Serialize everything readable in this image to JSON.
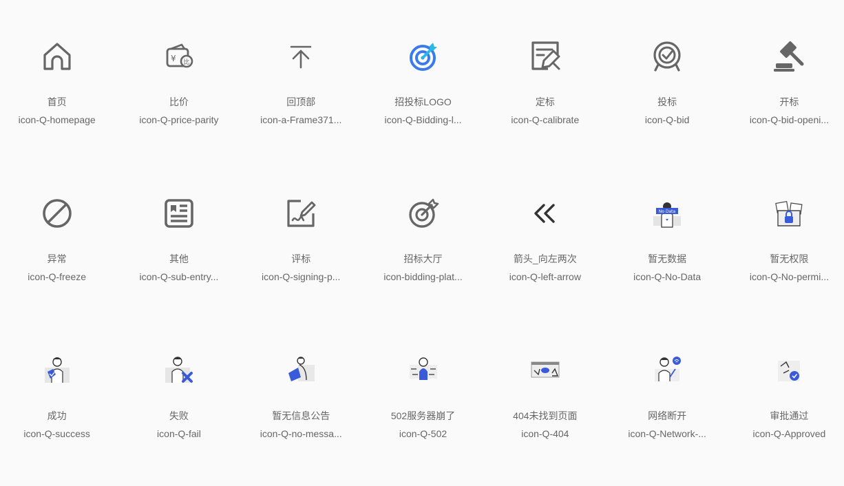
{
  "icons": [
    {
      "name": "首页",
      "code": "icon-Q-homepage",
      "glyph": "home-icon"
    },
    {
      "name": "比价",
      "code": "icon-Q-price-parity",
      "glyph": "price-parity-icon"
    },
    {
      "name": "回顶部",
      "code": "icon-a-Frame371...",
      "glyph": "back-to-top-icon"
    },
    {
      "name": "招投标LOGO",
      "code": "icon-Q-Bidding-l...",
      "glyph": "bidding-logo-icon"
    },
    {
      "name": "定标",
      "code": "icon-Q-calibrate",
      "glyph": "calibrate-icon"
    },
    {
      "name": "投标",
      "code": "icon-Q-bid",
      "glyph": "bid-icon"
    },
    {
      "name": "开标",
      "code": "icon-Q-bid-openi...",
      "glyph": "gavel-icon"
    },
    {
      "name": "异常",
      "code": "icon-Q-freeze",
      "glyph": "freeze-icon"
    },
    {
      "name": "其他",
      "code": "icon-Q-sub-entry...",
      "glyph": "sub-entry-icon"
    },
    {
      "name": "评标",
      "code": "icon-Q-signing-p...",
      "glyph": "signing-icon"
    },
    {
      "name": "招标大厅",
      "code": "icon-bidding-plat...",
      "glyph": "bidding-platform-icon"
    },
    {
      "name": "箭头_向左两次",
      "code": "icon-Q-left-arrow",
      "glyph": "double-left-arrow-icon"
    },
    {
      "name": "暂无数据",
      "code": "icon-Q-No-Data",
      "glyph": "no-data-illustration-icon",
      "badge": "No Data"
    },
    {
      "name": "暂无权限",
      "code": "icon-Q-No-permi...",
      "glyph": "no-permission-illustration-icon"
    },
    {
      "name": "成功",
      "code": "icon-Q-success",
      "glyph": "success-illustration-icon"
    },
    {
      "name": "失败",
      "code": "icon-Q-fail",
      "glyph": "fail-illustration-icon"
    },
    {
      "name": "暂无信息公告",
      "code": "icon-Q-no-messa...",
      "glyph": "no-message-illustration-icon"
    },
    {
      "name": "502服务器崩了",
      "code": "icon-Q-502",
      "glyph": "server-502-illustration-icon"
    },
    {
      "name": "404未找到页面",
      "code": "icon-Q-404",
      "glyph": "page-404-illustration-icon"
    },
    {
      "name": "网络断开",
      "code": "icon-Q-Network-...",
      "glyph": "network-disconnected-illustration-icon"
    },
    {
      "name": "审批通过",
      "code": "icon-Q-Approved",
      "glyph": "approved-illustration-icon"
    }
  ],
  "colors": {
    "icon_gray": "#666666",
    "accent_blue": "#3a7bea",
    "accent_cyan": "#2bb8e8",
    "text": "#666666",
    "background": "#fafafa"
  }
}
